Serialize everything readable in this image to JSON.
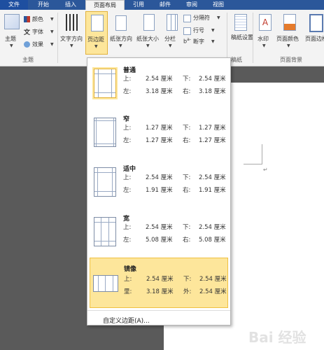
{
  "tabs": [
    "文件",
    "开始",
    "插入",
    "页面布局",
    "引用",
    "邮件",
    "审阅",
    "视图"
  ],
  "ribbon": {
    "theme_group": {
      "title": "主题",
      "theme_label": "主题",
      "colors_label": "颜色",
      "fonts_label": "字体",
      "effects_label": "效果"
    },
    "page_setup": {
      "text_direction": "文字方向",
      "margins": "页边距",
      "orientation": "纸张方向",
      "size": "纸张大小",
      "columns": "分栏",
      "breaks": "分隔符",
      "line_numbers": "行号",
      "hyphenation": "断字"
    },
    "draft_group": {
      "title": "稿纸",
      "draft_setup": "稿纸设置"
    },
    "background_group": {
      "title": "页面背景",
      "watermark": "水印",
      "page_color": "页面颜色",
      "page_border": "页面边框"
    }
  },
  "margins_menu": {
    "options": [
      {
        "name": "普通",
        "r1": [
          "上:",
          "2.54 厘米",
          "下:",
          "2.54 厘米"
        ],
        "r2": [
          "左:",
          "3.18 厘米",
          "右:",
          "3.18 厘米"
        ]
      },
      {
        "name": "窄",
        "r1": [
          "上:",
          "1.27 厘米",
          "下:",
          "1.27 厘米"
        ],
        "r2": [
          "左:",
          "1.27 厘米",
          "右:",
          "1.27 厘米"
        ]
      },
      {
        "name": "适中",
        "r1": [
          "上:",
          "2.54 厘米",
          "下:",
          "2.54 厘米"
        ],
        "r2": [
          "左:",
          "1.91 厘米",
          "右:",
          "1.91 厘米"
        ]
      },
      {
        "name": "宽",
        "r1": [
          "上:",
          "2.54 厘米",
          "下:",
          "2.54 厘米"
        ],
        "r2": [
          "左:",
          "5.08 厘米",
          "右:",
          "5.08 厘米"
        ]
      },
      {
        "name": "镜像",
        "r1": [
          "上:",
          "2.54 厘米",
          "下:",
          "2.54 厘米"
        ],
        "r2": [
          "里:",
          "3.18 厘米",
          "外:",
          "2.54 厘米"
        ]
      }
    ],
    "custom_label": "自定义边距(A)...",
    "highlighted_index": 4
  },
  "watermark_text": "Bai 经验",
  "colors": {
    "tab_bar": "#2b579a",
    "highlight": "#fde69b"
  }
}
